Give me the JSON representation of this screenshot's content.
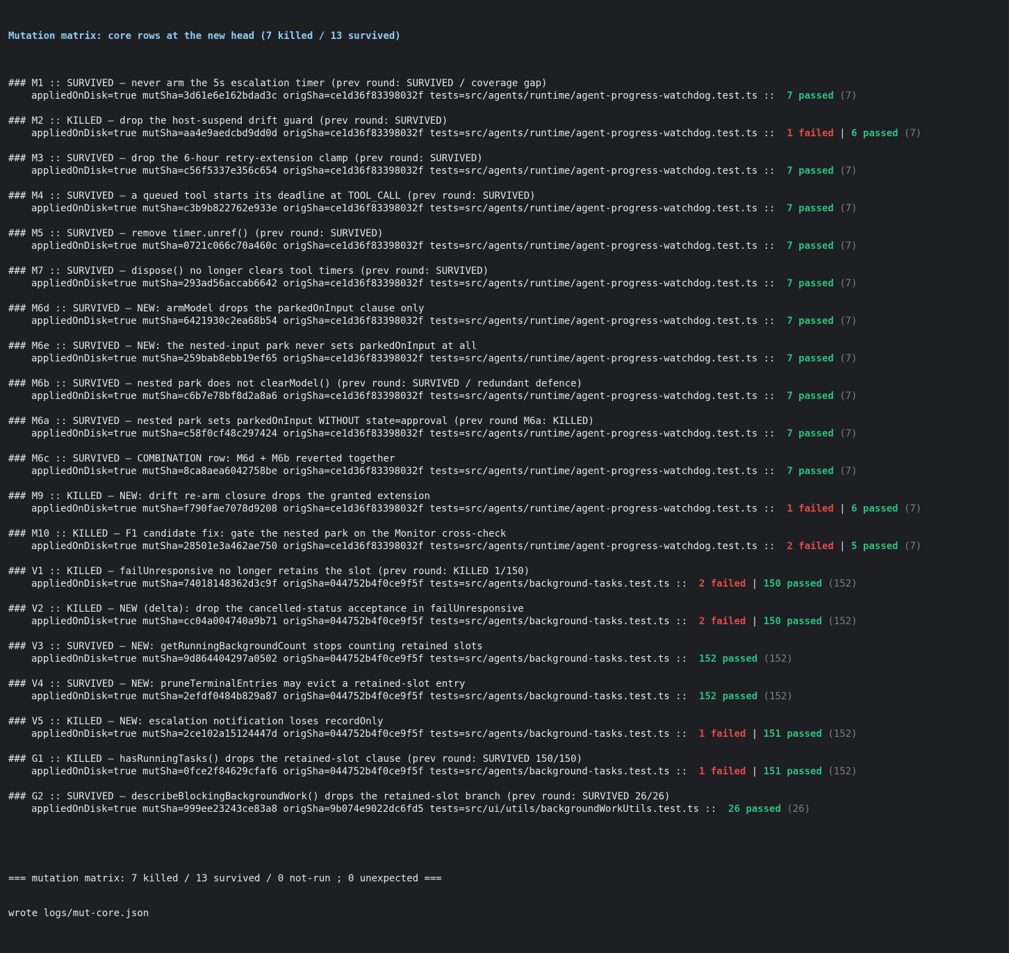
{
  "header": {
    "title": "Mutation matrix: core rows at the new head (7 killed / 13 survived)"
  },
  "rows": [
    {
      "head": "### M1 :: SURVIVED — never arm the 5s escalation timer (prev round: SURVIVED / coverage gap)",
      "detail": "appliedOnDisk=true mutSha=3d61e6e162bdad3c origSha=ce1d36f83398032f tests=src/agents/runtime/agent-progress-watchdog.test.ts :: ",
      "failed": "",
      "passed": "7 passed",
      "total": "(7)"
    },
    {
      "head": "### M2 :: KILLED — drop the host-suspend drift guard (prev round: SURVIVED)",
      "detail": "appliedOnDisk=true mutSha=aa4e9aedcbd9dd0d origSha=ce1d36f83398032f tests=src/agents/runtime/agent-progress-watchdog.test.ts :: ",
      "failed": "1 failed",
      "passed": "6 passed",
      "total": "(7)"
    },
    {
      "head": "### M3 :: SURVIVED — drop the 6-hour retry-extension clamp (prev round: SURVIVED)",
      "detail": "appliedOnDisk=true mutSha=c56f5337e356c654 origSha=ce1d36f83398032f tests=src/agents/runtime/agent-progress-watchdog.test.ts :: ",
      "failed": "",
      "passed": "7 passed",
      "total": "(7)"
    },
    {
      "head": "### M4 :: SURVIVED — a queued tool starts its deadline at TOOL_CALL (prev round: SURVIVED)",
      "detail": "appliedOnDisk=true mutSha=c3b9b822762e933e origSha=ce1d36f83398032f tests=src/agents/runtime/agent-progress-watchdog.test.ts :: ",
      "failed": "",
      "passed": "7 passed",
      "total": "(7)"
    },
    {
      "head": "### M5 :: SURVIVED — remove timer.unref() (prev round: SURVIVED)",
      "detail": "appliedOnDisk=true mutSha=0721c066c70a460c origSha=ce1d36f83398032f tests=src/agents/runtime/agent-progress-watchdog.test.ts :: ",
      "failed": "",
      "passed": "7 passed",
      "total": "(7)"
    },
    {
      "head": "### M7 :: SURVIVED — dispose() no longer clears tool timers (prev round: SURVIVED)",
      "detail": "appliedOnDisk=true mutSha=293ad56accab6642 origSha=ce1d36f83398032f tests=src/agents/runtime/agent-progress-watchdog.test.ts :: ",
      "failed": "",
      "passed": "7 passed",
      "total": "(7)"
    },
    {
      "head": "### M6d :: SURVIVED — NEW: armModel drops the parkedOnInput clause only",
      "detail": "appliedOnDisk=true mutSha=6421930c2ea68b54 origSha=ce1d36f83398032f tests=src/agents/runtime/agent-progress-watchdog.test.ts :: ",
      "failed": "",
      "passed": "7 passed",
      "total": "(7)"
    },
    {
      "head": "### M6e :: SURVIVED — NEW: the nested-input park never sets parkedOnInput at all",
      "detail": "appliedOnDisk=true mutSha=259bab8ebb19ef65 origSha=ce1d36f83398032f tests=src/agents/runtime/agent-progress-watchdog.test.ts :: ",
      "failed": "",
      "passed": "7 passed",
      "total": "(7)"
    },
    {
      "head": "### M6b :: SURVIVED — nested park does not clearModel() (prev round: SURVIVED / redundant defence)",
      "detail": "appliedOnDisk=true mutSha=c6b7e78bf8d2a8a6 origSha=ce1d36f83398032f tests=src/agents/runtime/agent-progress-watchdog.test.ts :: ",
      "failed": "",
      "passed": "7 passed",
      "total": "(7)"
    },
    {
      "head": "### M6a :: SURVIVED — nested park sets parkedOnInput WITHOUT state=approval (prev round M6a: KILLED)",
      "detail": "appliedOnDisk=true mutSha=c58f0cf48c297424 origSha=ce1d36f83398032f tests=src/agents/runtime/agent-progress-watchdog.test.ts :: ",
      "failed": "",
      "passed": "7 passed",
      "total": "(7)"
    },
    {
      "head": "### M6c :: SURVIVED — COMBINATION row: M6d + M6b reverted together",
      "detail": "appliedOnDisk=true mutSha=8ca8aea6042758be origSha=ce1d36f83398032f tests=src/agents/runtime/agent-progress-watchdog.test.ts :: ",
      "failed": "",
      "passed": "7 passed",
      "total": "(7)"
    },
    {
      "head": "### M9 :: KILLED — NEW: drift re-arm closure drops the granted extension",
      "detail": "appliedOnDisk=true mutSha=f790fae7078d9208 origSha=ce1d36f83398032f tests=src/agents/runtime/agent-progress-watchdog.test.ts :: ",
      "failed": "1 failed",
      "passed": "6 passed",
      "total": "(7)"
    },
    {
      "head": "### M10 :: KILLED — F1 candidate fix: gate the nested park on the Monitor cross-check",
      "detail": "appliedOnDisk=true mutSha=28501e3a462ae750 origSha=ce1d36f83398032f tests=src/agents/runtime/agent-progress-watchdog.test.ts :: ",
      "failed": "2 failed",
      "passed": "5 passed",
      "total": "(7)"
    },
    {
      "head": "### V1 :: KILLED — failUnresponsive no longer retains the slot (prev round: KILLED 1/150)",
      "detail": "appliedOnDisk=true mutSha=74018148362d3c9f origSha=044752b4f0ce9f5f tests=src/agents/background-tasks.test.ts :: ",
      "failed": "2 failed",
      "passed": "150 passed",
      "total": "(152)"
    },
    {
      "head": "### V2 :: KILLED — NEW (delta): drop the cancelled-status acceptance in failUnresponsive",
      "detail": "appliedOnDisk=true mutSha=cc04a004740a9b71 origSha=044752b4f0ce9f5f tests=src/agents/background-tasks.test.ts :: ",
      "failed": "2 failed",
      "passed": "150 passed",
      "total": "(152)"
    },
    {
      "head": "### V3 :: SURVIVED — NEW: getRunningBackgroundCount stops counting retained slots",
      "detail": "appliedOnDisk=true mutSha=9d864404297a0502 origSha=044752b4f0ce9f5f tests=src/agents/background-tasks.test.ts :: ",
      "failed": "",
      "passed": "152 passed",
      "total": "(152)"
    },
    {
      "head": "### V4 :: SURVIVED — NEW: pruneTerminalEntries may evict a retained-slot entry",
      "detail": "appliedOnDisk=true mutSha=2efdf0484b829a87 origSha=044752b4f0ce9f5f tests=src/agents/background-tasks.test.ts :: ",
      "failed": "",
      "passed": "152 passed",
      "total": "(152)"
    },
    {
      "head": "### V5 :: KILLED — NEW: escalation notification loses recordOnly",
      "detail": "appliedOnDisk=true mutSha=2ce102a15124447d origSha=044752b4f0ce9f5f tests=src/agents/background-tasks.test.ts :: ",
      "failed": "1 failed",
      "passed": "151 passed",
      "total": "(152)"
    },
    {
      "head": "### G1 :: KILLED — hasRunningTasks() drops the retained-slot clause (prev round: SURVIVED 150/150)",
      "detail": "appliedOnDisk=true mutSha=0fce2f84629cfaf6 origSha=044752b4f0ce9f5f tests=src/agents/background-tasks.test.ts :: ",
      "failed": "1 failed",
      "passed": "151 passed",
      "total": "(152)"
    },
    {
      "head": "### G2 :: SURVIVED — describeBlockingBackgroundWork() drops the retained-slot branch (prev round: SURVIVED 26/26)",
      "detail": "appliedOnDisk=true mutSha=999ee23243ce83a8 origSha=9b074e9022dc6fd5 tests=src/ui/utils/backgroundWorkUtils.test.ts :: ",
      "failed": "",
      "passed": "26 passed",
      "total": "(26)"
    }
  ],
  "separator": " | ",
  "footer": {
    "summary": "=== mutation matrix: 7 killed / 13 survived / 0 not-run ; 0 unexpected ===",
    "wrote": "wrote logs/mut-core.json"
  },
  "colors": {
    "background": "#1e1f22",
    "text": "#e6e6e6",
    "title": "#8ecdf8",
    "failed": "#e04b4b",
    "passed": "#2bbf82",
    "total": "#7f7f7f"
  }
}
